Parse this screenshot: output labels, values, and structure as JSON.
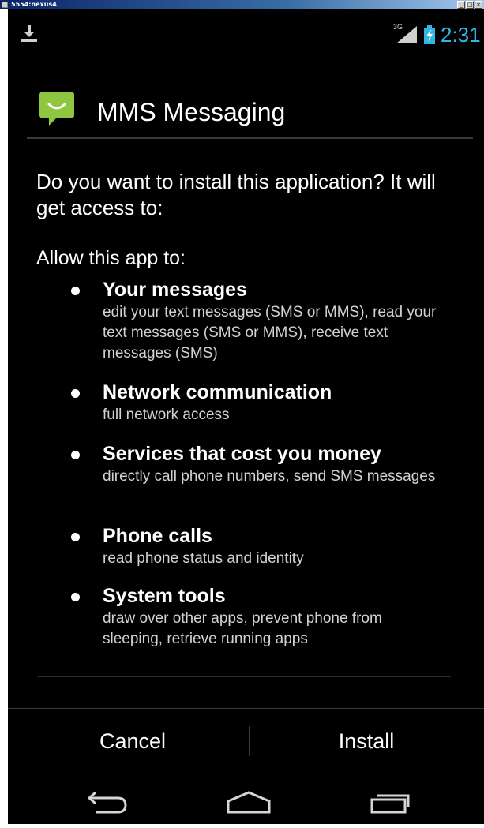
{
  "window": {
    "title": "5554:nexus4"
  },
  "status_bar": {
    "network_type": "3G",
    "clock": "2:31",
    "icons": [
      "download-notification-icon",
      "signal-icon",
      "battery-charging-icon"
    ]
  },
  "app": {
    "name": "MMS Messaging",
    "icon": "messaging-smiley-icon",
    "icon_color": "#8ec63f"
  },
  "question": "Do you want to install this application? It will get access to:",
  "allow_heading": "Allow this app to:",
  "permissions": [
    {
      "title": "Your messages",
      "description": "edit your text messages (SMS or MMS), read your text messages (SMS or MMS), receive text messages (SMS)"
    },
    {
      "title": "Network communication",
      "description": "full network access"
    },
    {
      "title": "Services that cost you money",
      "description": "directly call phone numbers, send SMS messages"
    },
    {
      "title": "Phone calls",
      "description": "read phone status and identity"
    },
    {
      "title": "System tools",
      "description": "draw over other apps, prevent phone from sleeping, retrieve running apps"
    }
  ],
  "buttons": {
    "cancel": "Cancel",
    "install": "Install"
  },
  "nav_bar": {
    "icons": [
      "back-icon",
      "home-icon",
      "recent-apps-icon"
    ]
  },
  "colors": {
    "accent": "#33b5e5",
    "background": "#000000",
    "text": "#ffffff"
  }
}
